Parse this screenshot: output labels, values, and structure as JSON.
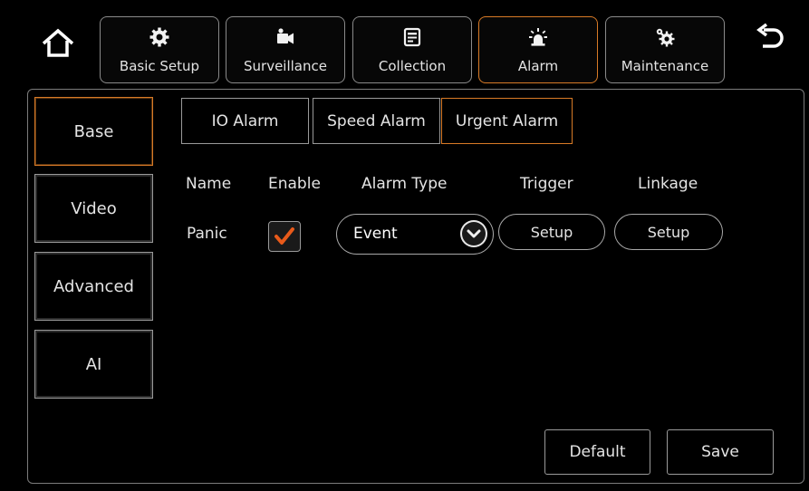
{
  "nav": {
    "tabs": [
      {
        "label": "Basic Setup",
        "icon": "gear-icon"
      },
      {
        "label": "Surveillance",
        "icon": "camera-icon"
      },
      {
        "label": "Collection",
        "icon": "document-icon"
      },
      {
        "label": "Alarm",
        "icon": "alarm-light-icon",
        "active": true
      },
      {
        "label": "Maintenance",
        "icon": "maintenance-gears-icon"
      }
    ]
  },
  "sidebar": {
    "items": [
      {
        "label": "Base",
        "active": true
      },
      {
        "label": "Video"
      },
      {
        "label": "Advanced"
      },
      {
        "label": "AI"
      }
    ]
  },
  "subtabs": [
    {
      "label": "IO Alarm"
    },
    {
      "label": "Speed Alarm"
    },
    {
      "label": "Urgent Alarm",
      "active": true
    }
  ],
  "table": {
    "headers": {
      "name": "Name",
      "enable": "Enable",
      "alarm_type": "Alarm Type",
      "trigger": "Trigger",
      "linkage": "Linkage"
    },
    "row": {
      "name": "Panic",
      "enabled": true,
      "alarm_type": "Event",
      "trigger_button": "Setup",
      "linkage_button": "Setup"
    }
  },
  "footer": {
    "default_label": "Default",
    "save_label": "Save"
  },
  "colors": {
    "accent": "#d87a26",
    "check": "#e85a1a"
  }
}
